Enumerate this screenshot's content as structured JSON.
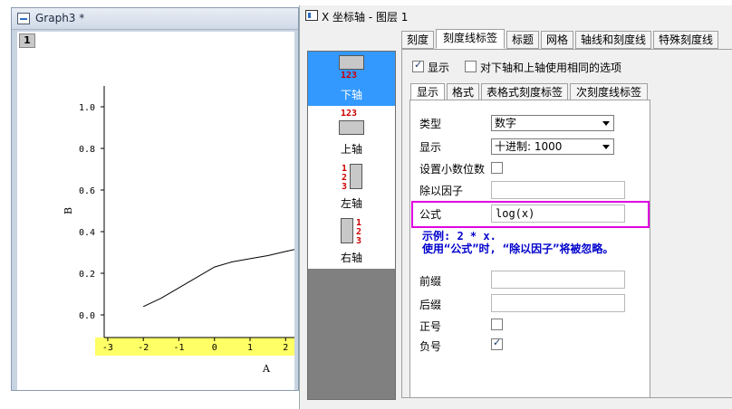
{
  "graph": {
    "window_title": "Graph3 *",
    "layer_badge": "1",
    "y_axis_label": "B",
    "x_axis_label": "A",
    "y_ticks": [
      "1.0",
      "0.8",
      "0.6",
      "0.4",
      "0.2",
      "0.0"
    ],
    "x_ticks": [
      "-3",
      "-2",
      "-1",
      "0",
      "1",
      "2"
    ],
    "highlight_color": "#ffff66"
  },
  "chart_data": {
    "type": "line",
    "xlabel": "A",
    "ylabel": "B",
    "xlim": [
      -3.1,
      2.4
    ],
    "ylim": [
      -0.1,
      1.1
    ],
    "series": [
      {
        "x": [
          -2,
          -1.5,
          -1,
          -0.5,
          0,
          0.5,
          1,
          1.5,
          2,
          2.4
        ],
        "y": [
          0.04,
          0.08,
          0.13,
          0.18,
          0.23,
          0.255,
          0.27,
          0.285,
          0.305,
          0.32
        ]
      }
    ]
  },
  "dialog": {
    "title": "X 坐标轴 - 图层 1",
    "axes": [
      {
        "label": "下轴",
        "glyph": "123",
        "selected": true
      },
      {
        "label": "上轴",
        "glyph": "123",
        "selected": false
      },
      {
        "label": "左轴",
        "glyph": "123",
        "selected": false
      },
      {
        "label": "右轴",
        "glyph": "123",
        "selected": false
      }
    ],
    "tabs": [
      "刻度",
      "刻度线标签",
      "标题",
      "网格",
      "轴线和刻度线",
      "特殊刻度线"
    ],
    "active_tab": "刻度线标签",
    "show_label": "显示",
    "same_options_label": "对下轴和上轴使用相同的选项",
    "subtabs": [
      "显示",
      "格式",
      "表格式刻度标签",
      "次刻度线标签"
    ],
    "active_subtab": "显示",
    "fields": {
      "type_label": "类型",
      "type_value": "数字",
      "display_label": "显示",
      "display_value": "十进制: 1000",
      "decimal_label": "设置小数位数",
      "divide_label": "除以因子",
      "formula_label": "公式",
      "formula_value": "log(x)",
      "example_line1": "示例: 2 * x.",
      "example_line2": "使用“公式”时, “除以因子”将被忽略。",
      "prefix_label": "前缀",
      "suffix_label": "后缀",
      "plus_label": "正号",
      "minus_label": "负号"
    },
    "highlight_color": "#e000e0"
  }
}
